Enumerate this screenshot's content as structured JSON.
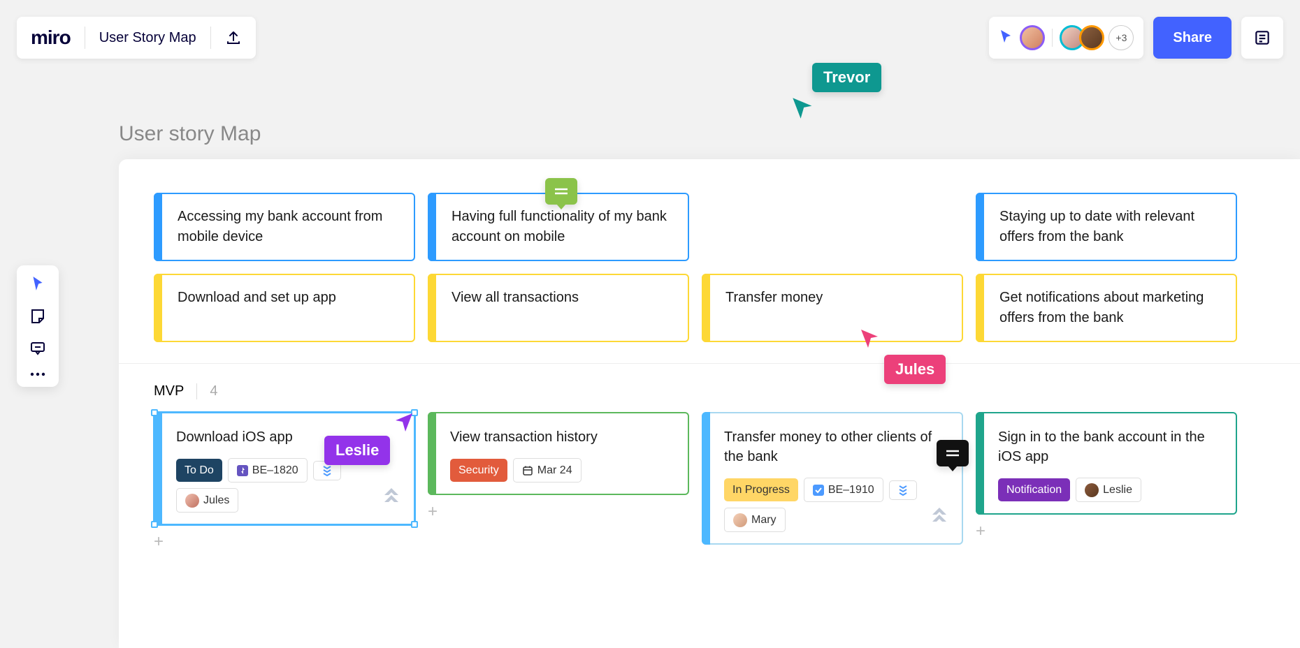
{
  "header": {
    "logo_text": "miro",
    "board_title": "User Story Map",
    "share_label": "Share",
    "avatar_overflow": "+3"
  },
  "canvas": {
    "title": "User story Map"
  },
  "activities": [
    {
      "text": "Accessing my bank account from mobile device"
    },
    {
      "text": "Having full functionality of my bank account on mobile"
    },
    {
      "text": ""
    },
    {
      "text": "Staying up to date with relevant offers from the bank"
    }
  ],
  "steps": [
    {
      "text": "Download and set up app"
    },
    {
      "text": "View all transactions"
    },
    {
      "text": "Transfer money"
    },
    {
      "text": "Get notifications about marketing offers from the bank"
    }
  ],
  "release": {
    "name": "MVP",
    "count": "4"
  },
  "stories": [
    {
      "title": "Download iOS app",
      "status": {
        "label": "To Do",
        "style": "dark"
      },
      "ticket": "BE–1820",
      "priority_icon": "priority-low",
      "assignee": "Jules",
      "jira": true,
      "color": "lightblue",
      "selected": true
    },
    {
      "title": "View transaction history",
      "tag": {
        "label": "Security",
        "style": "red"
      },
      "date": "Mar 24",
      "color": "green"
    },
    {
      "title": "Transfer money to other clients of the bank",
      "status": {
        "label": "In Progress",
        "style": "amber"
      },
      "ticket": "BE–1910",
      "priority_icon": "priority-low",
      "assignee": "Mary",
      "jira": true,
      "color": "lightblue"
    },
    {
      "title": "Sign in to the bank account in the iOS app",
      "tag": {
        "label": "Notification",
        "style": "purple"
      },
      "assignee": "Leslie",
      "color": "teal"
    }
  ],
  "cursors": {
    "trevor": "Trevor",
    "jules": "Jules",
    "leslie": "Leslie"
  }
}
